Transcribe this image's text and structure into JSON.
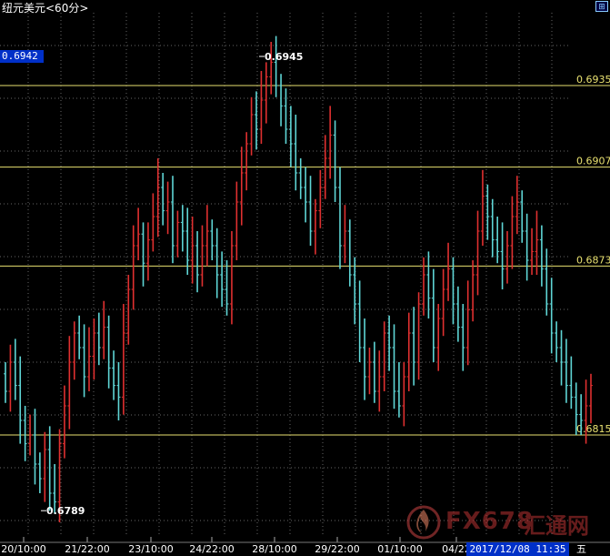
{
  "window": {
    "title": "纽元美元<60分>",
    "button_glyph": "⊞",
    "current_price": "0.6942"
  },
  "status": {
    "datetime": "2017/12/08 11:35",
    "weekday": "五"
  },
  "watermark": {
    "brand": "FX678",
    "brand_cn": "汇通网",
    "logo": "fx678-flame-logo"
  },
  "colors": {
    "background": "#000000",
    "up_bar": "#e03030",
    "down_bar": "#5fd6d6",
    "level_line": "#e8e070",
    "grid": "#666666",
    "axis_text": "#ffffff",
    "price_tag_bg": "#0030c8"
  },
  "chart_data": {
    "type": "ohlc",
    "title": "纽元美元<60分>",
    "xlabel": "",
    "ylabel": "",
    "ylim": [
      0.678,
      0.696
    ],
    "grid": true,
    "x_ticks": [
      "20/10:00",
      "21/22:00",
      "23/10:00",
      "24/22:00",
      "28/10:00",
      "29/22:00",
      "01/10:00",
      "04/22"
    ],
    "horizontal_levels": [
      0.6935,
      0.6907,
      0.6873,
      0.6815
    ],
    "annotations": [
      {
        "label": "0.6945",
        "value": 0.6945
      },
      {
        "label": "0.6789",
        "value": 0.6789
      }
    ],
    "series": [
      {
        "closes": [
          0.683,
          0.684,
          0.6832,
          0.682,
          0.6812,
          0.6815,
          0.6805,
          0.68,
          0.681,
          0.6795,
          0.6792,
          0.6812,
          0.6825,
          0.684,
          0.685,
          0.6845,
          0.6835,
          0.6842,
          0.685,
          0.6845,
          0.6852,
          0.6838,
          0.6832,
          0.6828,
          0.685,
          0.6865,
          0.688,
          0.6884,
          0.6874,
          0.6882,
          0.689,
          0.69,
          0.6892,
          0.6895,
          0.688,
          0.6888,
          0.6885,
          0.6875,
          0.688,
          0.687,
          0.688,
          0.6885,
          0.688,
          0.687,
          0.6865,
          0.686,
          0.688,
          0.6895,
          0.6905,
          0.6915,
          0.6925,
          0.692,
          0.693,
          0.6938,
          0.6943,
          0.6935,
          0.6928,
          0.692,
          0.6915,
          0.6905,
          0.69,
          0.6895,
          0.6885,
          0.6892,
          0.69,
          0.691,
          0.6918,
          0.69,
          0.688,
          0.6885,
          0.687,
          0.686,
          0.6845,
          0.6835,
          0.684,
          0.683,
          0.6835,
          0.685,
          0.6845,
          0.683,
          0.6825,
          0.6835,
          0.685,
          0.684,
          0.686,
          0.687,
          0.6862,
          0.6845,
          0.6855,
          0.6865,
          0.6872,
          0.686,
          0.6852,
          0.6845,
          0.6858,
          0.687,
          0.6885,
          0.6897,
          0.689,
          0.6882,
          0.6878,
          0.6872,
          0.688,
          0.689,
          0.6895,
          0.6885,
          0.6875,
          0.6878,
          0.6882,
          0.6872,
          0.686,
          0.685,
          0.6845,
          0.684,
          0.6832,
          0.6828,
          0.6822,
          0.682,
          0.6825,
          0.6832
        ]
      }
    ]
  }
}
